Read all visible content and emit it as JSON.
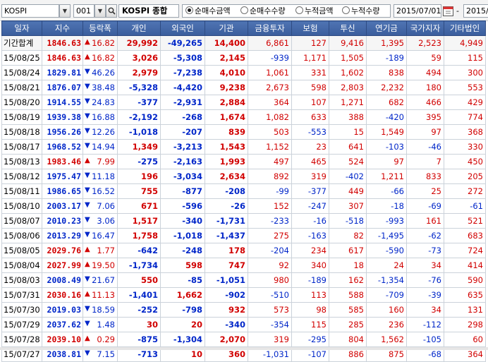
{
  "toolbar": {
    "market": "KOSPI",
    "code": "001",
    "index_name": "KOSPI 종합",
    "radios": [
      {
        "label": "순매수금액",
        "selected": true
      },
      {
        "label": "순매수수량",
        "selected": false
      },
      {
        "label": "누적금액",
        "selected": false
      },
      {
        "label": "누적수량",
        "selected": false
      }
    ],
    "date_from": "2015/07/01",
    "date_sep": "-",
    "date_to": "2015/"
  },
  "colors": {
    "header_bg": "#4369ab",
    "up": "#d10000",
    "down": "#0026c9"
  },
  "columns": [
    "일자",
    "지수",
    "등락폭",
    "개인",
    "외국인",
    "기관",
    "금융투자",
    "보험",
    "투신",
    "연기금",
    "국가지자",
    "기타법인"
  ],
  "rows": [
    {
      "date": "기간합계",
      "idx": "1846.63",
      "dir": "up",
      "chg": "16.82",
      "v": [
        "29,992",
        "-49,265",
        "14,400",
        "6,861",
        "127",
        "9,416",
        "1,395",
        "2,523",
        "4,949"
      ]
    },
    {
      "date": "15/08/25",
      "idx": "1846.63",
      "dir": "up",
      "chg": "16.82",
      "v": [
        "3,026",
        "-5,308",
        "2,145",
        "-939",
        "1,171",
        "1,505",
        "-189",
        "59",
        "115"
      ]
    },
    {
      "date": "15/08/24",
      "idx": "1829.81",
      "dir": "dn",
      "chg": "46.26",
      "v": [
        "2,979",
        "-7,238",
        "4,010",
        "1,061",
        "331",
        "1,602",
        "838",
        "494",
        "300"
      ]
    },
    {
      "date": "15/08/21",
      "idx": "1876.07",
      "dir": "dn",
      "chg": "38.48",
      "v": [
        "-5,328",
        "-4,420",
        "9,238",
        "2,673",
        "598",
        "2,803",
        "2,232",
        "180",
        "553"
      ]
    },
    {
      "date": "15/08/20",
      "idx": "1914.55",
      "dir": "dn",
      "chg": "24.83",
      "v": [
        "-377",
        "-2,931",
        "2,884",
        "364",
        "107",
        "1,271",
        "682",
        "466",
        "429"
      ]
    },
    {
      "date": "15/08/19",
      "idx": "1939.38",
      "dir": "dn",
      "chg": "16.88",
      "v": [
        "-2,192",
        "-268",
        "1,674",
        "1,082",
        "633",
        "388",
        "-420",
        "395",
        "774"
      ]
    },
    {
      "date": "15/08/18",
      "idx": "1956.26",
      "dir": "dn",
      "chg": "12.26",
      "v": [
        "-1,018",
        "-207",
        "839",
        "503",
        "-553",
        "15",
        "1,549",
        "97",
        "368"
      ]
    },
    {
      "date": "15/08/17",
      "idx": "1968.52",
      "dir": "dn",
      "chg": "14.94",
      "v": [
        "1,349",
        "-3,213",
        "1,543",
        "1,152",
        "23",
        "641",
        "-103",
        "-46",
        "330"
      ]
    },
    {
      "date": "15/08/13",
      "idx": "1983.46",
      "dir": "up",
      "chg": "7.99",
      "v": [
        "-275",
        "-2,163",
        "1,993",
        "497",
        "465",
        "524",
        "97",
        "7",
        "450"
      ]
    },
    {
      "date": "15/08/12",
      "idx": "1975.47",
      "dir": "dn",
      "chg": "11.18",
      "v": [
        "196",
        "-3,034",
        "2,634",
        "892",
        "319",
        "-402",
        "1,211",
        "833",
        "205"
      ]
    },
    {
      "date": "15/08/11",
      "idx": "1986.65",
      "dir": "dn",
      "chg": "16.52",
      "v": [
        "755",
        "-877",
        "-208",
        "-99",
        "-377",
        "449",
        "-66",
        "25",
        "272"
      ]
    },
    {
      "date": "15/08/10",
      "idx": "2003.17",
      "dir": "dn",
      "chg": "7.06",
      "v": [
        "671",
        "-596",
        "-26",
        "152",
        "-247",
        "307",
        "-18",
        "-69",
        "-61"
      ]
    },
    {
      "date": "15/08/07",
      "idx": "2010.23",
      "dir": "dn",
      "chg": "3.06",
      "v": [
        "1,517",
        "-340",
        "-1,731",
        "-233",
        "-16",
        "-518",
        "-993",
        "161",
        "521"
      ]
    },
    {
      "date": "15/08/06",
      "idx": "2013.29",
      "dir": "dn",
      "chg": "16.47",
      "v": [
        "1,758",
        "-1,018",
        "-1,437",
        "275",
        "-163",
        "82",
        "-1,495",
        "-62",
        "683"
      ]
    },
    {
      "date": "15/08/05",
      "idx": "2029.76",
      "dir": "up",
      "chg": "1.77",
      "v": [
        "-642",
        "-248",
        "178",
        "-204",
        "234",
        "617",
        "-590",
        "-73",
        "724"
      ]
    },
    {
      "date": "15/08/04",
      "idx": "2027.99",
      "dir": "up",
      "chg": "19.50",
      "v": [
        "-1,734",
        "598",
        "747",
        "92",
        "340",
        "18",
        "24",
        "34",
        "414"
      ]
    },
    {
      "date": "15/08/03",
      "idx": "2008.49",
      "dir": "dn",
      "chg": "21.67",
      "v": [
        "550",
        "-85",
        "-1,051",
        "980",
        "-189",
        "162",
        "-1,354",
        "-76",
        "590"
      ]
    },
    {
      "date": "15/07/31",
      "idx": "2030.16",
      "dir": "up",
      "chg": "11.13",
      "v": [
        "-1,401",
        "1,662",
        "-902",
        "-510",
        "113",
        "588",
        "-709",
        "-39",
        "635"
      ]
    },
    {
      "date": "15/07/30",
      "idx": "2019.03",
      "dir": "dn",
      "chg": "18.59",
      "v": [
        "-252",
        "-798",
        "932",
        "573",
        "98",
        "585",
        "160",
        "34",
        "131"
      ]
    },
    {
      "date": "15/07/29",
      "idx": "2037.62",
      "dir": "dn",
      "chg": "1.48",
      "v": [
        "30",
        "20",
        "-340",
        "-354",
        "115",
        "285",
        "236",
        "-112",
        "298"
      ]
    },
    {
      "date": "15/07/28",
      "idx": "2039.10",
      "dir": "up",
      "chg": "0.29",
      "v": [
        "-875",
        "-1,304",
        "2,070",
        "319",
        "-295",
        "804",
        "1,562",
        "-105",
        "60"
      ]
    },
    {
      "date": "15/07/27",
      "idx": "2038.81",
      "dir": "dn",
      "chg": "7.15",
      "v": [
        "-713",
        "10",
        "360",
        "-1,031",
        "-107",
        "886",
        "875",
        "-68",
        "364"
      ]
    }
  ]
}
